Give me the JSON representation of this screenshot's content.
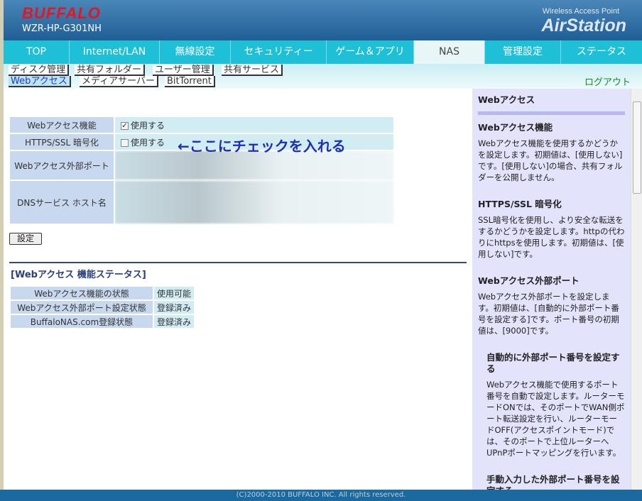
{
  "header": {
    "brand": "BUFFALO",
    "model": "WZR-HP-G301NH",
    "tagline": "Wireless Access Point",
    "product": "AirStation"
  },
  "nav": [
    "TOP",
    "Internet/LAN",
    "無線設定",
    "セキュリティー",
    "ゲーム＆アプリ",
    "NAS",
    "管理設定",
    "ステータス"
  ],
  "subnav": {
    "row1": [
      "ディスク管理",
      "共有フォルダー",
      "ユーザー管理",
      "共有サービス"
    ],
    "row2": [
      "Webアクセス",
      "メディアサーバー",
      "BitTorrent"
    ],
    "logout": "ログアウト"
  },
  "form": {
    "rows": [
      {
        "label": "Webアクセス機能",
        "checkbox_label": "使用する",
        "checked": true
      },
      {
        "label": "HTTPS/SSL 暗号化",
        "checkbox_label": "使用する",
        "checked": false
      },
      {
        "label": "Webアクセス外部ポート"
      },
      {
        "label": "DNSサービス ホスト名"
      }
    ],
    "annotation": "←ここにチェックを入れる",
    "submit": "設定"
  },
  "status": {
    "title": "[Webアクセス 機能ステータス]",
    "rows": [
      {
        "label": "Webアクセス機能の状態",
        "value": "使用可能"
      },
      {
        "label": "Webアクセス外部ポート設定状態",
        "value": "登録済み"
      },
      {
        "label": "BuffaloNAS.com登録状態",
        "value": "登録済み"
      }
    ]
  },
  "help": {
    "title": "Webアクセス",
    "sections": [
      {
        "h": "Webアクセス機能",
        "p": "Webアクセス機能を使用するかどうかを設定します。初期値は、[使用しない]です。[使用しない]の場合、共有フォルダーを公開しません。"
      },
      {
        "h": "HTTPS/SSL 暗号化",
        "p": "SSL暗号化を使用し、より安全な転送をするかどうかを設定します。httpの代わりにhttpsを使用します。初期値は、[使用しない]です。"
      },
      {
        "h": "Webアクセス外部ポート",
        "p": "Webアクセス外部ポートを設定します。初期値は、[自動的に外部ポート番号を設定する]です。ポート番号の初期値は、[9000]です。"
      },
      {
        "h": "自動的に外部ポート番号を設定する",
        "p": "Webアクセス機能で使用するポート番号を自動で設定します。ルーターモードONでは、そのポートでWAN側ポート転送設定を行い、ルーターモードOFF(アクセスポイントモード)では、そのポートで上位ルーターへUPnPポートマッピングを行います。"
      },
      {
        "h": "手動入力した外部ポート番号を設定する"
      }
    ]
  },
  "footer": "(C)2000-2010 BUFFALO INC. All rights reserved."
}
